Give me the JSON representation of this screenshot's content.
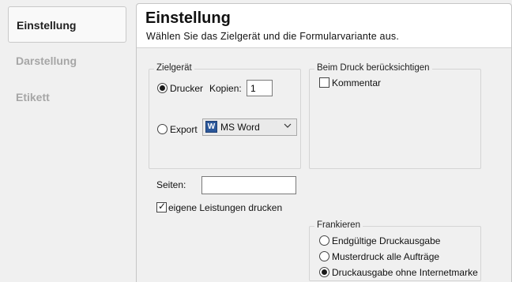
{
  "sidebar": {
    "items": [
      {
        "label": "Einstellung",
        "active": true
      },
      {
        "label": "Darstellung",
        "active": false
      },
      {
        "label": "Etikett",
        "active": false
      }
    ]
  },
  "header": {
    "title": "Einstellung",
    "subtitle": "Wählen Sie das Zielgerät und die Formularvariante aus."
  },
  "zielgeraet": {
    "group_label": "Zielgerät",
    "drucker_label": "Drucker",
    "drucker_selected": true,
    "kopien_label": "Kopien:",
    "kopien_value": "1",
    "export_label": "Export",
    "export_selected": false,
    "export_format": "MS Word",
    "export_icon": "word-icon"
  },
  "druck": {
    "group_label": "Beim Druck berücksichtigen",
    "kommentar_label": "Kommentar",
    "kommentar_checked": false
  },
  "seiten": {
    "label": "Seiten:",
    "value": ""
  },
  "leistungen": {
    "label": "eigene Leistungen drucken",
    "checked": true
  },
  "frankieren": {
    "group_label": "Frankieren",
    "options": [
      {
        "label": "Endgültige Druckausgabe",
        "selected": false
      },
      {
        "label": "Musterdruck alle Aufträge",
        "selected": false
      },
      {
        "label": "Druckausgabe ohne Internetmarke",
        "selected": true
      }
    ]
  }
}
